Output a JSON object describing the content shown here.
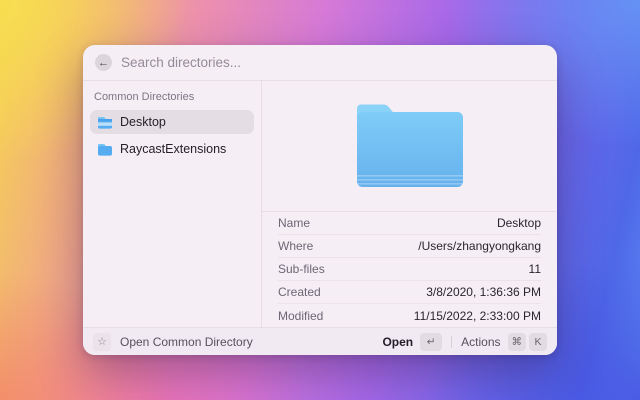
{
  "search": {
    "placeholder": "Search directories..."
  },
  "icons": {
    "back": "←",
    "star": "☆",
    "enter": "↵",
    "cmd": "⌘"
  },
  "sidebar": {
    "section_header": "Common Directories",
    "items": [
      {
        "label": "Desktop",
        "selected": true
      },
      {
        "label": "RaycastExtensions",
        "selected": false
      }
    ]
  },
  "details": {
    "rows": [
      {
        "label": "Name",
        "value": "Desktop"
      },
      {
        "label": "Where",
        "value": "/Users/zhangyongkang"
      },
      {
        "label": "Sub-files",
        "value": "11"
      },
      {
        "label": "Created",
        "value": "3/8/2020, 1:36:36 PM"
      },
      {
        "label": "Modified",
        "value": "11/15/2022, 2:33:00 PM"
      }
    ]
  },
  "action_bar": {
    "left_label": "Open Common Directory",
    "primary_action": "Open",
    "secondary_action": "Actions",
    "secondary_keys": [
      "⌘",
      "K"
    ]
  },
  "colors": {
    "folder_blue": "#64b5f0",
    "selection": "#e5dde4",
    "window_bg": "#f5eef5"
  }
}
